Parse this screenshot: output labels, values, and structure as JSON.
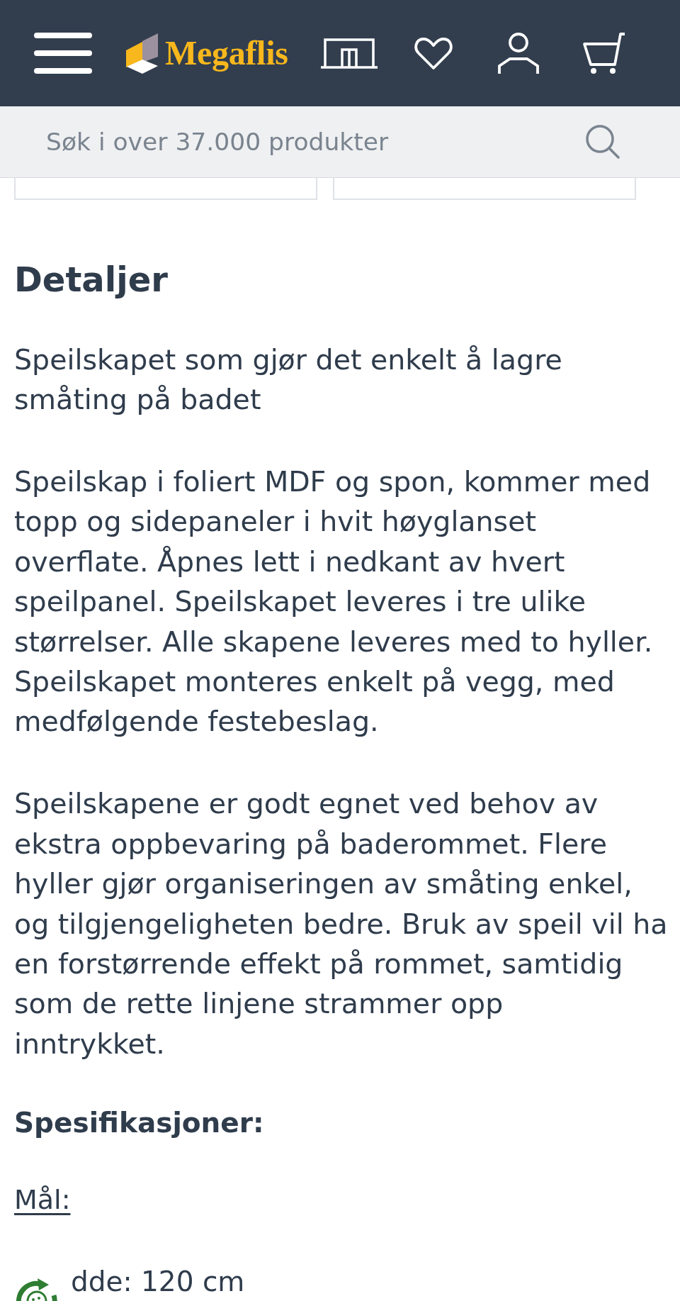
{
  "header": {
    "logo": "Megaflis"
  },
  "search": {
    "placeholder": "Søk i over 37.000 produkter"
  },
  "details": {
    "title": "Detaljer",
    "paragraphs": [
      "Speilskapet som gjør det enkelt å lagre\nsmåting på badet",
      "Speilskap i foliert MDF og spon, kommer med\ntopp og sidepaneler i hvit høyglanset\noverflate. Åpnes lett i nedkant av hvert\nspeilpanel. Speilskapet leveres i tre ulike\nstørrelser. Alle skapene leveres med to hyller.\nSpeilskapet monteres enkelt på vegg, med\nmedfølgende festebeslag.",
      "Speilskapene er godt egnet ved behov av\nekstra oppbevaring på baderommet. Flere\nhyller gjør organiseringen av småting enkel,\nog tilgjengeligheten bedre. Bruk av speil vil ha\nen forstørrende effekt på rommet, samtidig\nsom de rette linjene strammer opp\ninntrykket."
    ]
  },
  "specifications": {
    "title": "Spesifikasjoner:",
    "subheading": "Mål:",
    "lines": [
      "dde: 120 cm"
    ]
  }
}
